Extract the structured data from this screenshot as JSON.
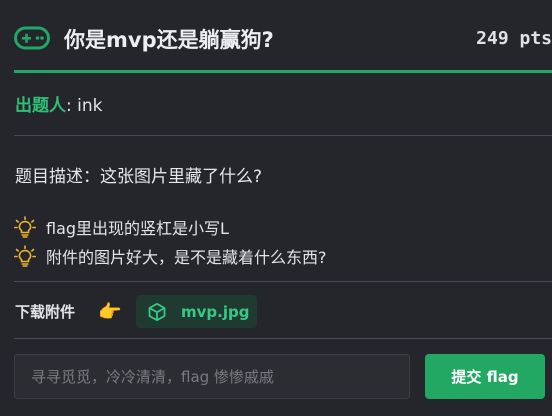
{
  "challenge": {
    "title": "你是mvp还是躺赢狗?",
    "points": "249 pts"
  },
  "author": {
    "label": "出题人",
    "separator": ": ",
    "name": "ink"
  },
  "description": "题目描述：这张图片里藏了什么?",
  "hints": [
    "flag里出现的竖杠是小写L",
    "附件的图片好大，是不是藏着什么东西?"
  ],
  "attachments": {
    "label": "下载附件",
    "pointer_emoji": "👉",
    "file_name": "mvp.jpg"
  },
  "flag_form": {
    "placeholder": "寻寻觅觅，冷冷清清，flag 惨惨戚戚",
    "value": "",
    "submit_label": "提交 flag"
  },
  "colors": {
    "accent": "#1fa866",
    "background": "#25262b",
    "hint_bulb": "#f0b429"
  },
  "icons": {
    "header": "gamepad-icon",
    "hint": "lightbulb-icon",
    "file": "cube-icon"
  }
}
